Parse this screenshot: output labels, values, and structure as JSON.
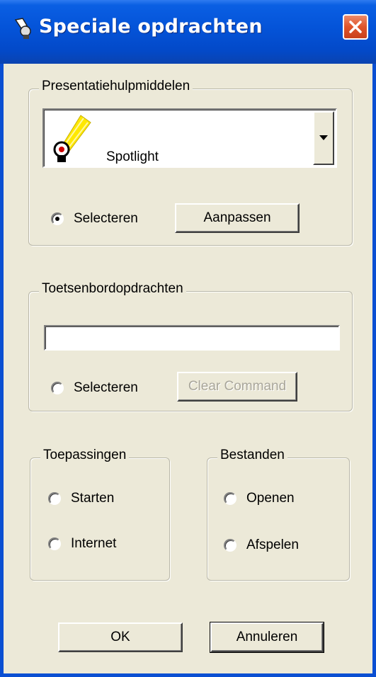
{
  "window": {
    "title": "Speciale opdrachten",
    "close_icon": "close-icon"
  },
  "presentation": {
    "group_label": "Presentatiehulpmiddelen",
    "selected_tool": "Spotlight",
    "tool_icon": "spotlight-icon",
    "radio_label": "Selecteren",
    "radio_checked": true,
    "customize_button": "Aanpassen"
  },
  "keyboard": {
    "group_label": "Toetsenbordopdrachten",
    "command_value": "",
    "radio_label": "Selecteren",
    "radio_checked": false,
    "clear_button": "Clear Command"
  },
  "applications": {
    "group_label": "Toepassingen",
    "options": [
      "Starten",
      "Internet"
    ]
  },
  "files": {
    "group_label": "Bestanden",
    "options": [
      "Openen",
      "Afspelen"
    ]
  },
  "footer": {
    "ok_label": "OK",
    "cancel_label": "Annuleren"
  },
  "colors": {
    "titlebar": "#0453D8",
    "dialog_bg": "#ECE9D8",
    "close_button": "#E0542A"
  }
}
